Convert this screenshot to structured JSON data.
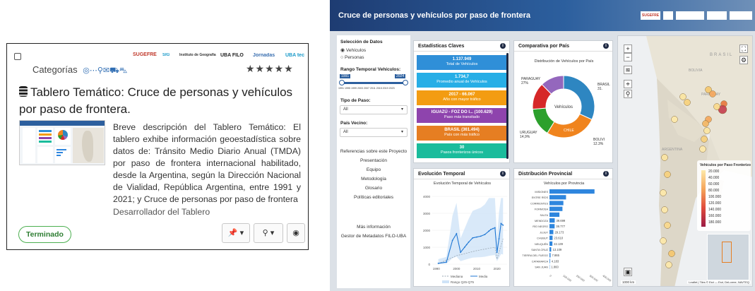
{
  "card": {
    "categories_label": "Categorías",
    "category_icons": [
      "target-icon",
      "ellipsis-icon",
      "map-pin-icon",
      "chat-icon",
      "truck-icon",
      "cart-icon"
    ],
    "logos": [
      "SUGEFRE",
      "SIG",
      "Instituto de Geografía \"Romualdo Ardissone\"",
      "UBA FILO",
      "Jornadas",
      "UBA tec"
    ],
    "rating": "★★★★★",
    "title_icon": "database-icon",
    "title": "Tablero Temático: Cruce de personas y vehículos por paso de frontera.",
    "description": "Breve descripción del Tablero Temático: El tablero exhibe información geoestadística sobre datos de: Tránsito Medio Diario Anual (TMDA) por paso de frontera internacional habilitado, desde la Argentina, según la Dirección Nacional de Vialidad, República Argentina, entre 1991 y 2021; y Cruce de personas por paso de frontera",
    "developer": "Desarrollador del Tablero",
    "status": "Terminado",
    "buttons": {
      "pin": "📌 ▾",
      "share": "⚲ ▾",
      "globe": "◉"
    }
  },
  "dashboard": {
    "title": "Cruce de personas y vehículos por paso de frontera",
    "sidebar": {
      "data_selection_label": "Selección de Datos",
      "radio_vehicles": "Vehículos",
      "radio_people": "Personas",
      "range_label": "Rango Temporal Vehículos:",
      "range_start": "1991",
      "range_end": "2024",
      "range_ticks": "1991 1995 1999 2003 2007 2011 2015 2019 2023",
      "pass_type_label": "Tipo de Paso:",
      "pass_type_value": "All",
      "country_label": "País Vecino:",
      "country_value": "All",
      "links": [
        "Referencias sobre este Proyecto",
        "Presentación",
        "Equipo",
        "Metodología",
        "Glosario",
        "Políticas editoriales"
      ],
      "more_info": "Más información",
      "metadata": "Gestor de Metadatos FILO-UBA"
    },
    "stats": {
      "title": "Estadísticas Claves",
      "boxes": [
        {
          "value": "1.137.949",
          "label": "Total de Vehículos",
          "color": "#2f8fd8"
        },
        {
          "value": "1.734,7",
          "label": "Promedio anual de Vehículos",
          "color": "#27aee6"
        },
        {
          "value": "2017 - 66.067",
          "label": "Año con mayor tráfico",
          "color": "#f39c12"
        },
        {
          "value": "IGUAZÚ - FOZ DO I... (100.629)",
          "label": "Paso más transitado",
          "color": "#8e44ad"
        },
        {
          "value": "BRASIL (361.494)",
          "label": "País con más tráfico",
          "color": "#e67e22"
        },
        {
          "value": "30",
          "label": "Pasos fronterizos únicos",
          "color": "#1abc9c"
        }
      ]
    },
    "pie": {
      "title": "Comparativa por País",
      "subtitle": "Distribución de Vehículos por País",
      "center": "Vehículos",
      "labels": [
        "PARAGUAY 27%",
        "BRASIL 31.",
        "URUGUAY 14,9%",
        "CHILE",
        "BOLIVI 12.3%"
      ]
    },
    "temporal": {
      "title": "Evolución Temporal",
      "subtitle": "Evolución Temporal de Vehículos",
      "yticks": [
        "4000",
        "3000",
        "2000",
        "1000",
        "0"
      ],
      "xticks": [
        "1990",
        "2000",
        "2010",
        "2020"
      ],
      "legend": [
        "Mediana",
        "Media",
        "Rango Q25-Q75"
      ]
    },
    "provincial": {
      "title": "Distribución Provincial",
      "subtitle": "Vehículos por Provincia",
      "xticks": [
        "0",
        "100.000",
        "200.000",
        "300.000",
        "400.000"
      ]
    },
    "map": {
      "labels": [
        "BRASIL",
        "BOLIVIA",
        "PARAGUAY",
        "ARGENTINA"
      ],
      "legend_title": "Vehículos por Paso Fronterizo",
      "legend_values": [
        "20.000",
        "40.000",
        "60.000",
        "80.000",
        "100.000",
        "120.000",
        "140.000",
        "160.000",
        "180.000"
      ],
      "scale": "1000 km",
      "attribution": "Leaflet | Tiles © Esri — Esri, DeLorme, NAVTEQ"
    }
  },
  "chart_data": [
    {
      "type": "pie",
      "title": "Distribución de Vehículos por País",
      "categories": [
        "BRASIL",
        "PARAGUAY",
        "URUGUAY",
        "CHILE",
        "BOLIVIA"
      ],
      "values": [
        31.8,
        27,
        14.9,
        14,
        12.3
      ],
      "colors": [
        "#2e86c1",
        "#f0841e",
        "#2ca02c",
        "#d62728",
        "#9467bd"
      ]
    },
    {
      "type": "bar",
      "title": "Vehículos por Provincia",
      "categories": [
        "MISIONES",
        "ENTRE RÍOS",
        "CORRIENTES",
        "FORMOSA",
        "SALTA",
        "MENDOZA",
        "RÍO NEGRO",
        "JUJUY",
        "CHUBUT",
        "NEUQUÉN",
        "SANTA CRUZ",
        "TIERRA DEL FUEGO",
        "CATAMARCA",
        "SAN JUAN"
      ],
      "values": [
        340000,
        125000,
        105000,
        98000,
        75000,
        39699,
        38777,
        29173,
        23610,
        22139,
        13109,
        7865,
        4183,
        1860
      ],
      "value_labels": [
        "",
        "",
        "",
        "",
        "",
        "39.699",
        "38.777",
        "29.173",
        "23.610",
        "22.139",
        "13.109",
        "7.865",
        "4.183",
        "1.860"
      ],
      "color": "#2e86de"
    },
    {
      "type": "line",
      "title": "Evolución Temporal de Vehículos",
      "ylim": [
        0,
        4000
      ],
      "series": [
        {
          "name": "Media",
          "x": [
            1991,
            1995,
            1998,
            2000,
            2002,
            2004,
            2005,
            2006,
            2008,
            2010,
            2012,
            2014,
            2016,
            2017,
            2018,
            2019,
            2020,
            2021,
            2022,
            2023
          ],
          "values": [
            50,
            120,
            1400,
            1800,
            700,
            1000,
            1150,
            1300,
            1550,
            1600,
            1650,
            1750,
            1950,
            2050,
            2100,
            2150,
            700,
            1500,
            2400,
            2300
          ]
        },
        {
          "name": "Mediana",
          "x": [
            1991,
            2000,
            2010,
            2019,
            2020,
            2023
          ],
          "values": [
            30,
            500,
            800,
            1000,
            300,
            1500
          ]
        }
      ]
    }
  ]
}
